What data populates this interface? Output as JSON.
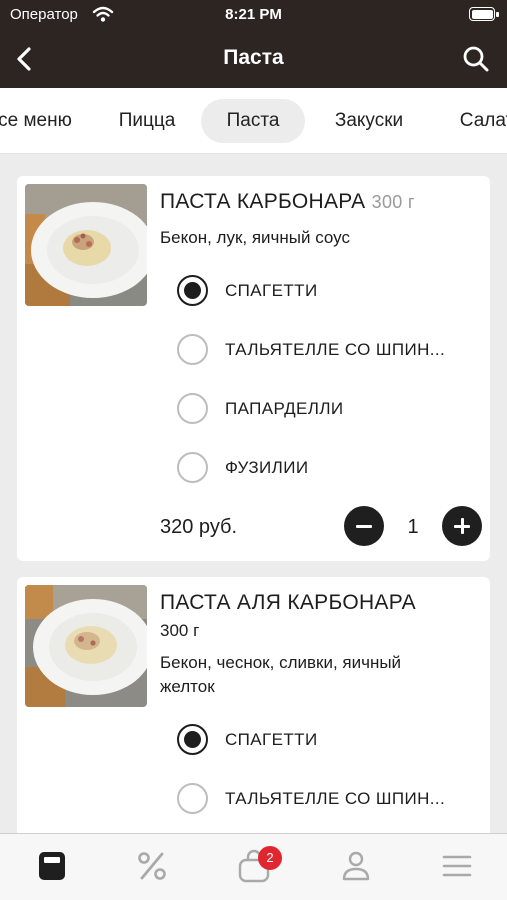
{
  "status_bar": {
    "carrier": "Оператор",
    "time": "8:21 PM"
  },
  "nav": {
    "title": "Паста",
    "back_icon": "chevron-left-icon",
    "search_icon": "search-icon"
  },
  "tabs": [
    {
      "label": "се меню",
      "active": false
    },
    {
      "label": "Пицца",
      "active": false
    },
    {
      "label": "Паста",
      "active": true
    },
    {
      "label": "Закуски",
      "active": false
    },
    {
      "label": "Салат",
      "active": false
    }
  ],
  "products": [
    {
      "name": "ПАСТА КАРБОНАРА",
      "weight": "300 г",
      "description": "Бекон, лук, яичный соус",
      "options": [
        {
          "label": "СПАГЕТТИ",
          "selected": true
        },
        {
          "label": "ТАЛЬЯТЕЛЛЕ СО ШПИН...",
          "selected": false
        },
        {
          "label": "ПАПАРДЕЛЛИ",
          "selected": false
        },
        {
          "label": "ФУЗИЛИИ",
          "selected": false
        }
      ],
      "price": "320 руб.",
      "quantity": "1"
    },
    {
      "name": "ПАСТА АЛЯ КАРБОНАРА",
      "weight": "300 г",
      "description_line1": "Бекон, чеснок, сливки, яичный",
      "description_line2": "желток",
      "options": [
        {
          "label": "СПАГЕТТИ",
          "selected": true
        },
        {
          "label": "ТАЛЬЯТЕЛЛЕ СО ШПИН...",
          "selected": false
        }
      ]
    }
  ],
  "bottom_nav": {
    "items": [
      "menu-icon",
      "discount-icon",
      "cart-icon",
      "profile-icon",
      "hamburger-icon"
    ],
    "active": "menu-icon",
    "cart_badge": "2"
  },
  "colors": {
    "header": "#2c2522",
    "badge": "#e0262e",
    "accent": "#1f1f1f"
  }
}
